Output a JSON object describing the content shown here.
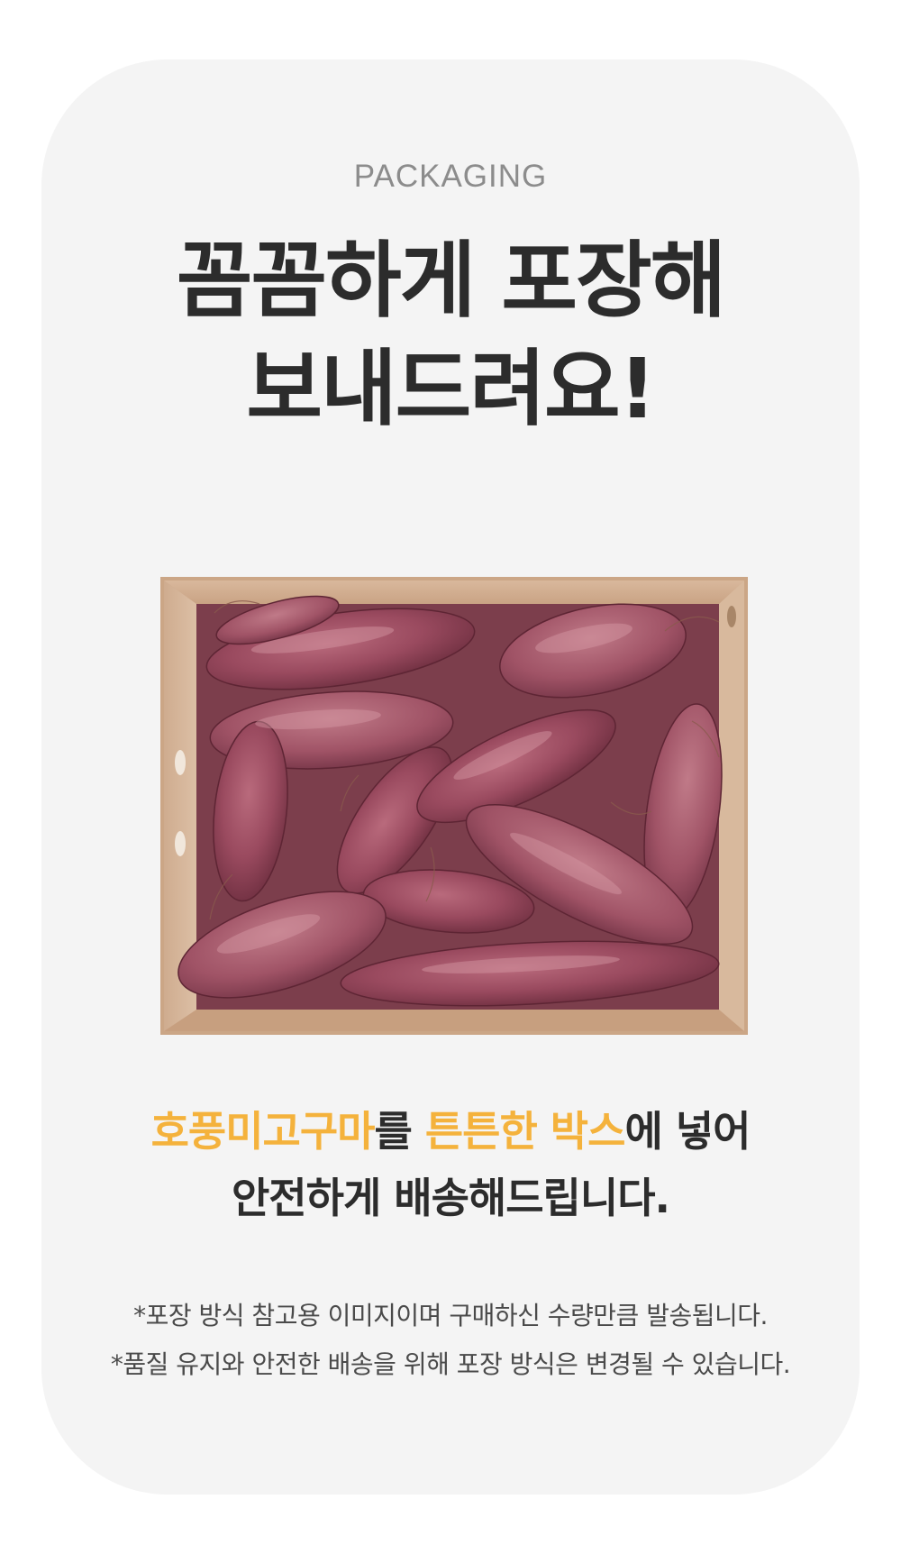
{
  "section_label": "PACKAGING",
  "headline": {
    "line1": "꼼꼼하게 포장해",
    "line2": "보내드려요!"
  },
  "body": {
    "line1": {
      "accent_a": "호풍미고구마",
      "mid": "를 ",
      "accent_b": "튼튼한 박스",
      "end": "에 넣어"
    },
    "line2": "안전하게 배송해드립니다."
  },
  "notes": [
    "*포장 방식 참고용 이미지이며 구매하신 수량만큼 발송됩니다.",
    "*품질 유지와 안전한 배송을 위해 포장 방식은 변경될 수 있습니다."
  ],
  "colors": {
    "card_background": "#f4f4f4",
    "headline_text": "#2c2c2c",
    "accent": "#f4b23c",
    "label_gray": "#8c8c8c"
  }
}
